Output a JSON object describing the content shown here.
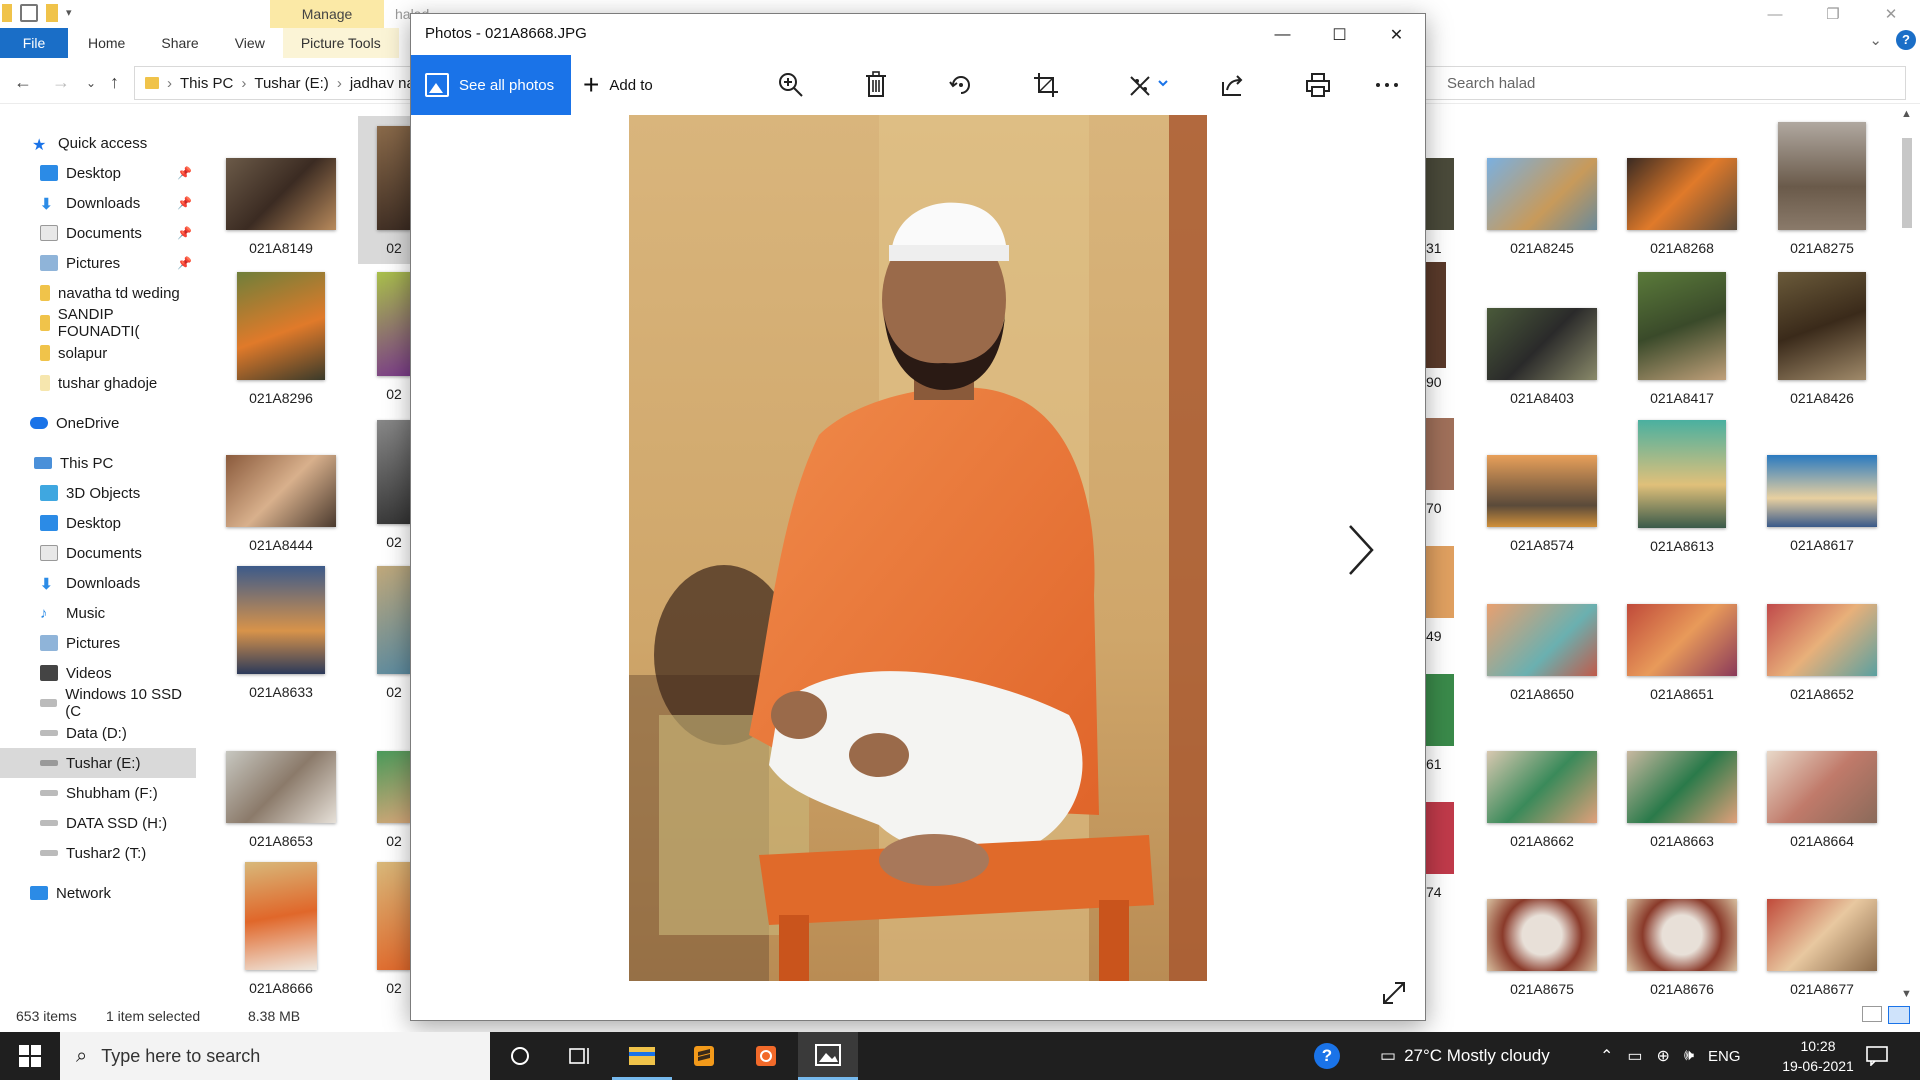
{
  "explorer": {
    "manage_tab": "Manage",
    "folder_title": "halad",
    "tabs": [
      "File",
      "Home",
      "Share",
      "View",
      "Picture Tools"
    ],
    "breadcrumb": [
      "This PC",
      "Tushar (E:)",
      "jadhav na"
    ],
    "search_placeholder": "Search halad",
    "sidebar": {
      "quick_access": "Quick access",
      "quick_items": [
        "Desktop",
        "Downloads",
        "Documents",
        "Pictures",
        "navatha td weding",
        "SANDIP FOUNADTI(",
        "solapur",
        "tushar ghadoje"
      ],
      "onedrive": "OneDrive",
      "this_pc": "This PC",
      "pc_items": [
        "3D Objects",
        "Desktop",
        "Documents",
        "Downloads",
        "Music",
        "Pictures",
        "Videos",
        "Windows 10 SSD (C",
        "Data (D:)",
        "Tushar (E:)",
        "Shubham (F:)",
        "DATA SSD (H:)",
        "Tushar2 (T:)"
      ],
      "network": "Network"
    },
    "left_col": [
      "021A8149",
      "021A8296",
      "021A8444",
      "021A8633",
      "021A8653",
      "021A8666"
    ],
    "second_col_partial": [
      "02",
      "02",
      "02",
      "02",
      "02",
      "02"
    ],
    "partial_right": [
      "31",
      "90",
      "70",
      "49",
      "61",
      "74"
    ],
    "right_cols": [
      [
        "021A8245",
        "021A8268",
        "021A8275"
      ],
      [
        "021A8403",
        "021A8417",
        "021A8426"
      ],
      [
        "021A8574",
        "021A8613",
        "021A8617"
      ],
      [
        "021A8650",
        "021A8651",
        "021A8652"
      ],
      [
        "021A8662",
        "021A8663",
        "021A8664"
      ],
      [
        "021A8675",
        "021A8676",
        "021A8677"
      ]
    ],
    "status": {
      "count": "653 items",
      "selected": "1 item selected",
      "size": "8.38 MB"
    }
  },
  "photos": {
    "title": "Photos - 021A8668.JPG",
    "see_all": "See all photos",
    "add_to": "Add to"
  },
  "taskbar": {
    "search_placeholder": "Type here to search",
    "weather": "27°C  Mostly cloudy",
    "lang": "ENG",
    "time": "10:28",
    "date": "19-06-2021"
  }
}
